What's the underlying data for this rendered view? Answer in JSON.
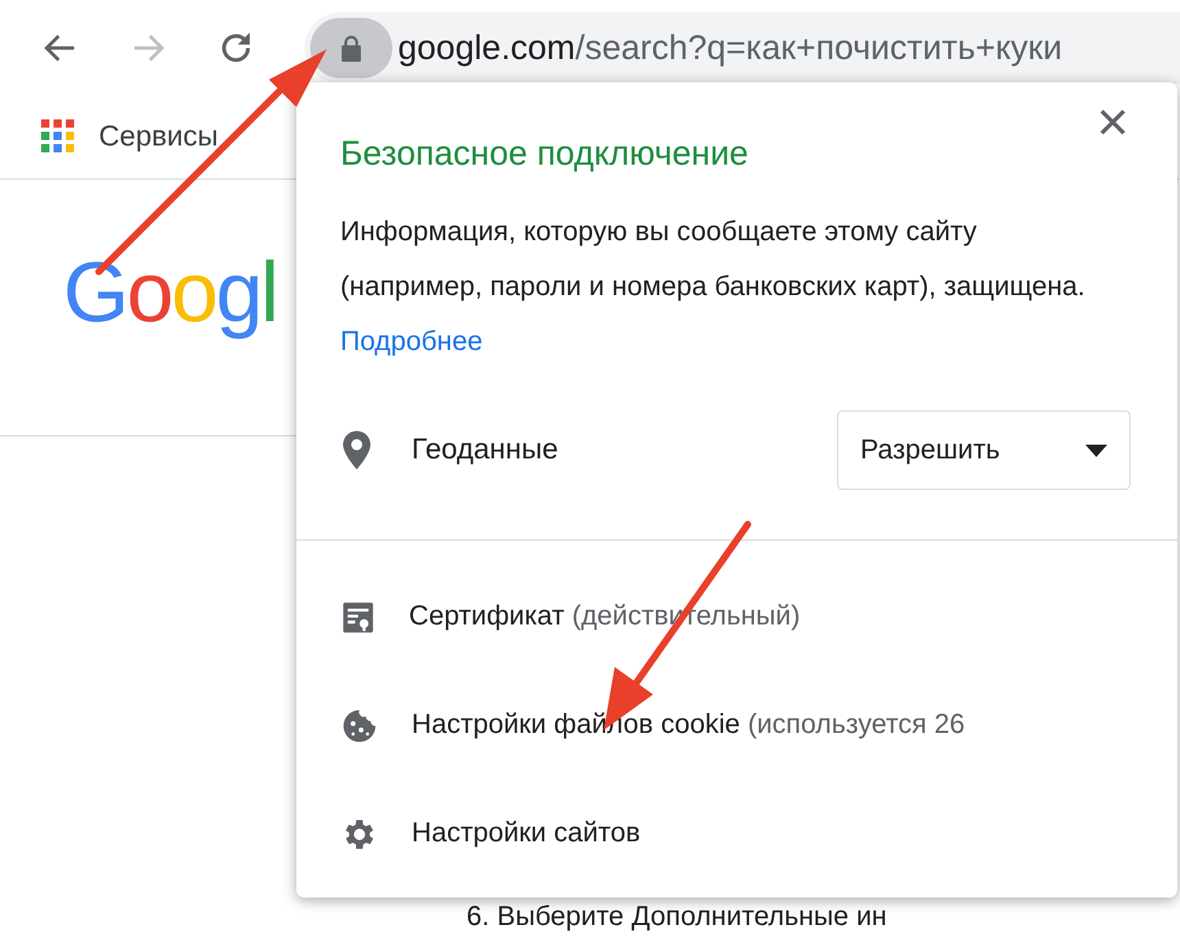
{
  "toolbar": {
    "url_host": "google.com",
    "url_path": "/search?q=как+почистить+куки"
  },
  "bookmarks": [
    {
      "label": "Сервисы"
    }
  ],
  "page": {
    "logo": "Googl",
    "cut_line": "6. Выберите Дополнительные ин"
  },
  "popup": {
    "title": "Безопасное подключение",
    "description": "Информация, которую вы сообщаете этому сайту (например, пароли и номера банковских карт), защищена.",
    "link": "Подробнее",
    "permission": {
      "label": "Геоданные",
      "value": "Разрешить"
    },
    "items": [
      {
        "kind": "certificate",
        "label": "Сертификат",
        "note": "(действительный)"
      },
      {
        "kind": "cookie",
        "label": "Настройки файлов cookie",
        "note": "(используется 26"
      },
      {
        "kind": "settings",
        "label": "Настройки сайтов"
      }
    ]
  }
}
